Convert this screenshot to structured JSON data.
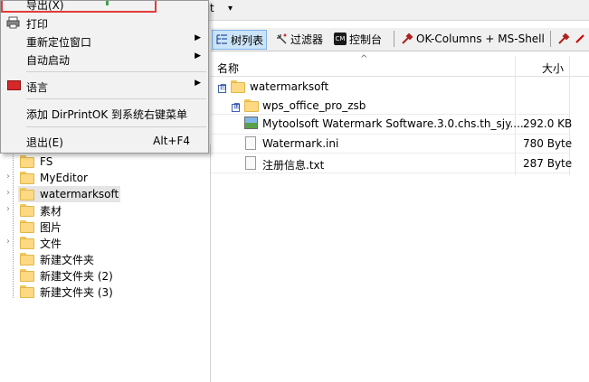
{
  "menubar": {
    "partial_label": "t",
    "arrow": "▾"
  },
  "menu": {
    "items": [
      {
        "label": "导出(X)",
        "shortcut": "",
        "submenu": false
      },
      {
        "label": "打印",
        "shortcut": "",
        "submenu": false
      },
      {
        "label": "重新定位窗口",
        "shortcut": "",
        "submenu": true
      },
      {
        "label": "自动启动",
        "shortcut": "",
        "submenu": true
      },
      {
        "label": "语言",
        "shortcut": "",
        "submenu": true
      },
      {
        "label": "添加 DirPrintOK 到系统右键菜单",
        "shortcut": "",
        "submenu": false
      },
      {
        "label": "退出(E)",
        "shortcut": "Alt+F4",
        "submenu": false
      }
    ],
    "submenu_arrow": "▶"
  },
  "toolbar": {
    "tree_view": "树列表",
    "filter": "过滤器",
    "console": "控制台",
    "console_icon_text": "CM",
    "ok_columns": "OK-Columns + MS-Shell"
  },
  "list": {
    "col_name": "名称",
    "col_size": "大小",
    "sort_arrow": "^",
    "rows": [
      {
        "name": "watermarksoft",
        "size": "",
        "type": "folder",
        "expander": "⊟"
      },
      {
        "name": "wps_office_pro_zsb",
        "size": "",
        "type": "folder",
        "expander": "⊞"
      },
      {
        "name": "Mytoolsoft Watermark Software.3.0.chs.th_sjy....",
        "size": "292.0 KB",
        "type": "image"
      },
      {
        "name": "Watermark.ini",
        "size": "780 Byte",
        "type": "ini"
      },
      {
        "name": "注册信息.txt",
        "size": "287 Byte",
        "type": "txt"
      }
    ]
  },
  "tree": {
    "expand_arrow": "›",
    "items": [
      {
        "label": "FS",
        "has_arrow": false
      },
      {
        "label": "MyEditor",
        "has_arrow": true
      },
      {
        "label": "watermarksoft",
        "has_arrow": true,
        "selected": true
      },
      {
        "label": "素材",
        "has_arrow": true
      },
      {
        "label": "图片",
        "has_arrow": false
      },
      {
        "label": "文件",
        "has_arrow": true
      },
      {
        "label": "新建文件夹",
        "has_arrow": false
      },
      {
        "label": "新建文件夹 (2)",
        "has_arrow": false
      },
      {
        "label": "新建文件夹 (3)",
        "has_arrow": false
      }
    ]
  },
  "colors": {
    "highlight_border": "#e23b3b",
    "selection": "#cce4f7"
  }
}
